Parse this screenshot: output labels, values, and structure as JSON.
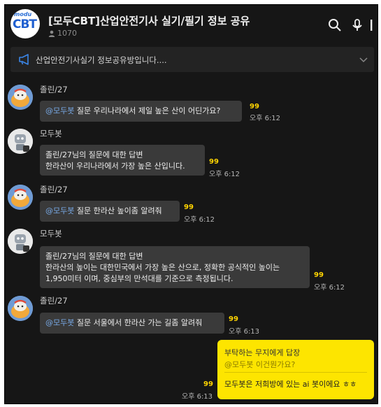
{
  "header": {
    "logo_small": "modu",
    "logo_big": "CBT",
    "title": "[모두CBT]산업안전기사 실기/필기 정보 공유",
    "member_count": "1070"
  },
  "notice": {
    "text": "산업안전기사실기 정보공유방입니다...."
  },
  "messages": [
    {
      "sender": "졸린/27",
      "mention": "@모두봇",
      "text": " 질문 우리나라에서 제일 높은 산이 어딘가요?",
      "unread": "99",
      "time": "오후 6:12"
    },
    {
      "sender": "모두봇",
      "lines": [
        "졸린/27님의 질문에 대한 답변",
        "한라산이 우리나라에서 가장 높은 산입니다."
      ],
      "unread": "99",
      "time": "오후 6:12"
    },
    {
      "sender": "졸린/27",
      "mention": "@모두봇",
      "text": " 질문 한라산 높이좀 알려줘",
      "unread": "99",
      "time": "오후 6:12"
    },
    {
      "sender": "모두봇",
      "lines": [
        "졸린/27님의 질문에 대한 답변",
        "한라산의 높이는 대한민국에서 가장 높은 산으로, 정확한 공식적인 높이는",
        "1,950미터 이며, 중심부의 만석대를 기준으로 측정됩니다."
      ],
      "unread": "99",
      "time": "오후 6:12"
    },
    {
      "sender": "졸린/27",
      "mention": "@모두봇",
      "text": " 질문 서울에서 한라산 가는 길좀 알려줘",
      "unread": "99",
      "time": "오후 6:13"
    }
  ],
  "my_message": {
    "quote_title": "부탁하는 무지에게 답장",
    "quote_text": "@모두봇 이건뭔가요?",
    "text": "모두봇은 저희방에 있는 ai 봇이에요 ㅎㅎ",
    "unread": "99",
    "time": "오후 6:13"
  },
  "colors": {
    "background": "#161616",
    "bubble": "#3a3a3a",
    "my_bubble": "#fde500",
    "unread": "#ffd400",
    "mention": "#78a9e6"
  },
  "icons": [
    "search-icon",
    "mic-icon",
    "more-icon",
    "megaphone-icon",
    "chevron-down-icon",
    "person-icon"
  ]
}
